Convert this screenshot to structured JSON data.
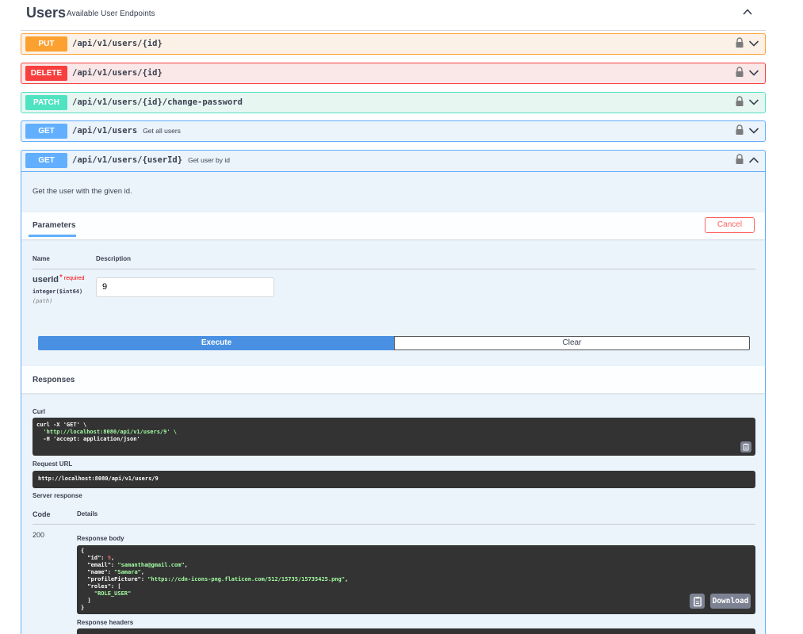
{
  "tag": {
    "title": "Users",
    "description": "Available User Endpoints",
    "icon": "chevron-up-icon"
  },
  "operations": [
    {
      "method": "PUT",
      "path": "/api/v1/users/{id}",
      "summary": ""
    },
    {
      "method": "DELETE",
      "path": "/api/v1/users/{id}",
      "summary": ""
    },
    {
      "method": "PATCH",
      "path": "/api/v1/users/{id}/change-password",
      "summary": ""
    },
    {
      "method": "GET",
      "path": "/api/v1/users",
      "summary": "Get all users"
    }
  ],
  "open_operation": {
    "method": "GET",
    "path": "/api/v1/users/{userId}",
    "summary": "Get user by id",
    "description": "Get the user with the given id.",
    "parameters_tab": "Parameters",
    "cancel_label": "Cancel",
    "col_name": "Name",
    "col_description": "Description",
    "param": {
      "name": "userId",
      "required_star": "*",
      "required_label": "required",
      "type": "integer($int64)",
      "in": "(path)",
      "value": "9"
    },
    "execute_label": "Execute",
    "clear_label": "Clear",
    "responses_title": "Responses",
    "curl_label": "Curl",
    "curl_lines": [
      "curl -X 'GET' \\",
      "  'http://localhost:8080/api/v1/users/9' \\",
      "  -H 'accept: application/json'"
    ],
    "request_url_label": "Request URL",
    "request_url": "http://localhost:8080/api/v1/users/9",
    "server_response_label": "Server response",
    "code_col": "Code",
    "details_col": "Details",
    "status_code": "200",
    "response_body_label": "Response body",
    "response_body": {
      "id": "9",
      "email": "samantha@gmail.com",
      "name": "Samara",
      "profilePicture": "https://cdn-icons-png.flaticon.com/512/15735/15735425.png",
      "roles": [
        "ROLE_USER"
      ]
    },
    "download_label": "Download",
    "response_headers_label": "Response headers"
  },
  "colors": {
    "put": "#fca130",
    "delete": "#f93e3e",
    "patch": "#50e3c2",
    "get": "#61affe",
    "execute": "#4990e2"
  }
}
